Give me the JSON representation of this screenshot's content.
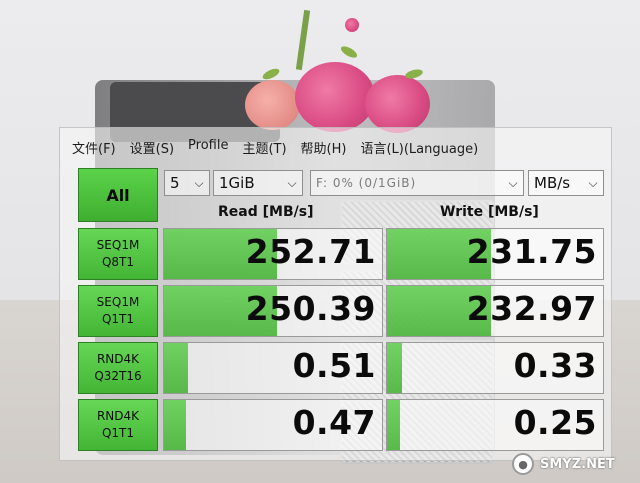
{
  "menu": [
    "文件(F)",
    "设置(S)",
    "Profile",
    "主题(T)",
    "帮助(H)",
    "语言(L)(Language)"
  ],
  "toolbar": {
    "all_label": "All",
    "count": "5",
    "size": "1GiB",
    "drive": "F: 0% (0/1GiB)",
    "unit": "MB/s"
  },
  "headers": {
    "read": "Read [MB/s]",
    "write": "Write [MB/s]"
  },
  "tests": [
    {
      "line1": "SEQ1M",
      "line2": "Q8T1",
      "read": "252.71",
      "write": "231.75",
      "read_fill": 0.52,
      "write_fill": 0.48
    },
    {
      "line1": "SEQ1M",
      "line2": "Q1T1",
      "read": "250.39",
      "write": "232.97",
      "read_fill": 0.52,
      "write_fill": 0.48
    },
    {
      "line1": "RND4K",
      "line2": "Q32T16",
      "read": "0.51",
      "write": "0.33",
      "read_fill": 0.11,
      "write_fill": 0.07
    },
    {
      "line1": "RND4K",
      "line2": "Q1T1",
      "read": "0.47",
      "write": "0.25",
      "read_fill": 0.1,
      "write_fill": 0.06
    }
  ],
  "watermark": "SMYZ.NET",
  "colors": {
    "accent_green": "#4ac23a",
    "bar_green": "#5ccd4c"
  },
  "icons": {
    "dropdown": "chevron-down-icon",
    "watermark_logo": "site-logo-icon"
  }
}
